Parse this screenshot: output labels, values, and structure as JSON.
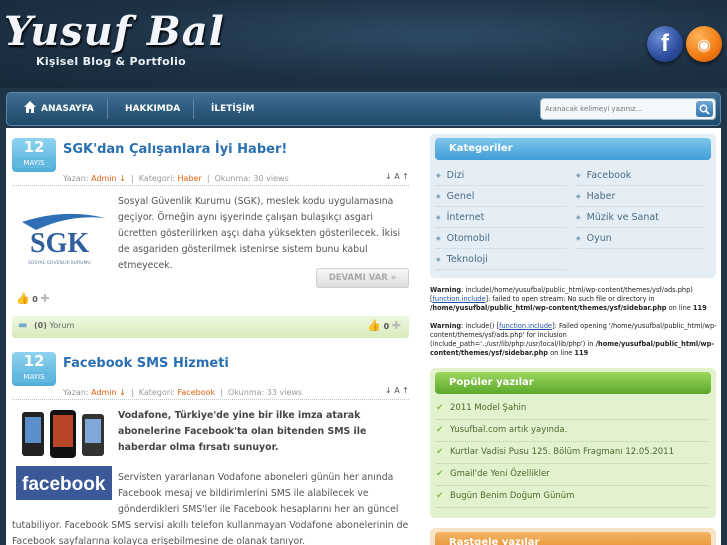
{
  "header": {
    "logo_title": "Yusuf Bal",
    "logo_subtitle": "Kişisel Blog & Portfolio",
    "facebook_glyph": "f",
    "rss_glyph": "◉"
  },
  "nav": {
    "items": [
      "ANASAYFA",
      "HAKKIMDA",
      "İLETİŞİM"
    ],
    "search_placeholder": "Aranacak kelimeyi yazınız..."
  },
  "posts": [
    {
      "day": "12",
      "month": "MAYIS",
      "title": "SGK'dan Çalışanlara İyi Haber!",
      "author_label": "Yazan:",
      "author": "Admin ↓",
      "category_label": "Kategori:",
      "category": "Haber",
      "views_label": "Okunma:",
      "views": "30 views",
      "icons": "↓ A ↑",
      "thumb_text": "SGK",
      "thumb_subtext": "SOSYAL GÜVENLİK KURUMU",
      "excerpt": "Sosyal Güvenlik Kurumu (SGK), meslek kodu uygulamasına geçiyor. Örneğin aynı işyerinde çalışan bulaşıkçı asgari ücretten gösterilirken aşçı daha yüksekten gösterilecek. İkisi de asgariden gösterilmek istenirse sistem bunu kabul etmeyecek.",
      "more_label": "DEVAMI VAR »",
      "likes": "0",
      "comments": "(0)",
      "comments_label": "Yorum",
      "likes_right": "0"
    },
    {
      "day": "12",
      "month": "MAYIS",
      "title": "Facebook SMS Hizmeti",
      "author_label": "Yazan:",
      "author": "Admin ↓",
      "category_label": "Kategori:",
      "category": "Facebook",
      "views_label": "Okunma:",
      "views": "33 views",
      "icons": "↓ A ↑",
      "thumb_text": "facebook",
      "lead": "Vodafone, Türkiye'de yine bir ilke imza atarak abonelerine Facebook'ta olan bitenden SMS ile haberdar olma fırsatı sunuyor.",
      "body": "Servisten yararlanan Vodafone aboneleri günün her anında Facebook mesaj ve bildirimlerini SMS ile alabilecek ve gönderdikleri SMS'ler ile Facebook hesaplarını her an güncel",
      "body2": "tutabiliyor. Facebook SMS servisi akıllı telefon kullanmayan Vodafone abonelerinin de Facebook sayfalarına kolayca erişebilmesine de olanak tanıyor."
    }
  ],
  "sidebar": {
    "categories_title": "Kategoriler",
    "categories_left": [
      "Dizi",
      "Genel",
      "İnternet",
      "Otomobil",
      "Teknoloji"
    ],
    "categories_right": [
      "Facebook",
      "Haber",
      "Müzik ve Sanat",
      "Oyun"
    ],
    "warning1": {
      "label": "Warning",
      "text1": ": include(/home/yusufbal/public_html/wp-content/themes/ysf/ads.php) [",
      "link": "function.include",
      "text2": "]: failed to open stream: No such file or directory in",
      "path": "/home/yusufbal/public_html/wp-content/themes/ysf/sidebar.php",
      "line_label": " on line ",
      "line": "119"
    },
    "warning2": {
      "label": "Warning",
      "text1": ": include() [",
      "link": "function.include",
      "text2": "]: Failed opening '/home/yusufbal/public_html/wp-content/themes/ysf/ads.php' for inclusion (include_path='.:/usr/lib/php:/usr/local/lib/php') in",
      "path": "/home/yusufbal/public_html/wp-content/themes/ysf/sidebar.php",
      "line_label": " on line ",
      "line": "119"
    },
    "popular_title": "Popüler yazılar",
    "popular_items": [
      "2011 Model Şahin",
      "Yusufbal.com artık yayında.",
      "Kurtlar Vadisi Pusu 125. Bölüm Fragmanı 12.05.2011",
      "Gmail'de Yeni Özellikler",
      "Bugün Benim Doğum Günüm"
    ],
    "random_title": "Rastgele yazılar"
  },
  "colors": {
    "accent_blue": "#2a6fb0",
    "accent_orange": "#e06010",
    "nav_bg": "#1f4868",
    "category_box": "#3f9ed6",
    "popular_box": "#5aa82c",
    "random_box": "#e28a2b"
  }
}
